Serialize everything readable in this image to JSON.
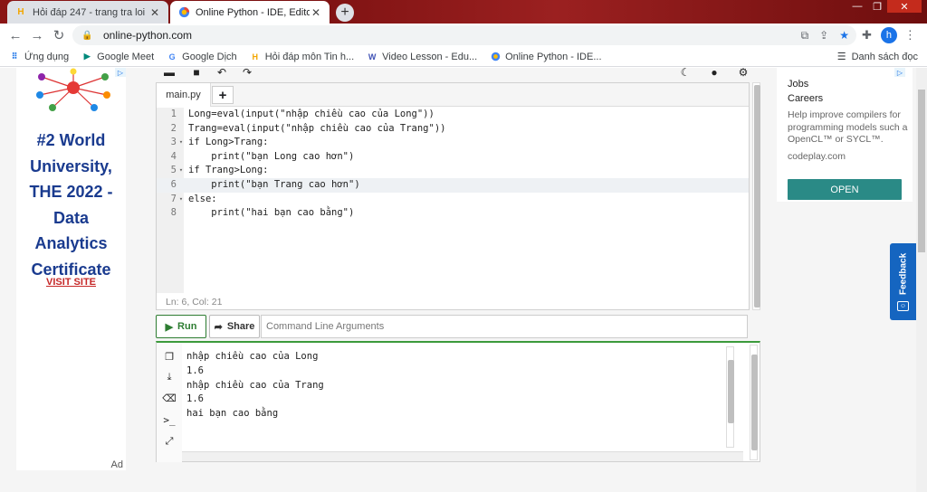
{
  "browser": {
    "tabs": [
      {
        "title": "Hỏi đáp 247 - trang tra loi",
        "favicon": "hoidap-icon"
      },
      {
        "title": "Online Python - IDE, Editor, Compiler",
        "favicon": "python-icon"
      }
    ],
    "newtab": "+",
    "url": "online-python.com",
    "profile_initial": "h",
    "bookmarks": [
      {
        "label": "Ứng dụng",
        "icon": "apps-grid-icon"
      },
      {
        "label": "Google Meet",
        "icon": "meet-icon"
      },
      {
        "label": "Google Dịch",
        "icon": "translate-icon"
      },
      {
        "label": "Hỏi đáp môn Tin h...",
        "icon": "hoidap-icon"
      },
      {
        "label": "Video Lesson - Edu...",
        "icon": "video-icon"
      },
      {
        "label": "Online Python - IDE...",
        "icon": "python-icon"
      }
    ],
    "reading_list": "Danh sách đọc"
  },
  "left_ad": {
    "headline": "#2 World University, THE 2022 - Data Analytics Certificate",
    "cta": "VISIT SITE",
    "ad_label": "Ad"
  },
  "ide": {
    "file_tab": "main.py",
    "add_tab": "+",
    "code_lines": [
      {
        "n": "1",
        "fold": "",
        "text": "Long=eval(input(\"nhập chiều cao của Long\"))"
      },
      {
        "n": "2",
        "fold": "",
        "text": "Trang=eval(input(\"nhập chiều cao của Trang\"))"
      },
      {
        "n": "3",
        "fold": "▾",
        "text": "if Long>Trang:"
      },
      {
        "n": "4",
        "fold": "",
        "text": "    print(\"bạn Long cao hơn\")"
      },
      {
        "n": "5",
        "fold": "▾",
        "text": "if Trang>Long:"
      },
      {
        "n": "6",
        "fold": "",
        "text": "    print(\"bạn Trang cao hơn\")"
      },
      {
        "n": "7",
        "fold": "▾",
        "text": "else:"
      },
      {
        "n": "8",
        "fold": "",
        "text": "    print(\"hai bạn cao bằng\")"
      }
    ],
    "status": "Ln: 6,  Col: 21",
    "run_label": "Run",
    "share_label": "Share",
    "cmd_placeholder": "Command Line Arguments",
    "console_output": [
      "nhập chiều cao của Long",
      "1.6",
      "nhập chiều cao của Trang",
      "1.6",
      "hai bạn cao bằng"
    ]
  },
  "right_ad": {
    "line1": "Jobs",
    "line2": "Careers",
    "description": "Help improve compilers for programming models such a OpenCL™ or SYCL™.",
    "domain": "codeplay.com",
    "cta": "OPEN"
  },
  "feedback_label": "Feedback",
  "colors": {
    "accent": "#1a73e8",
    "run_green": "#2e7d32",
    "open_teal": "#2a8a86",
    "feedback_blue": "#1565c0",
    "ad_headline": "#1a3b8f"
  }
}
